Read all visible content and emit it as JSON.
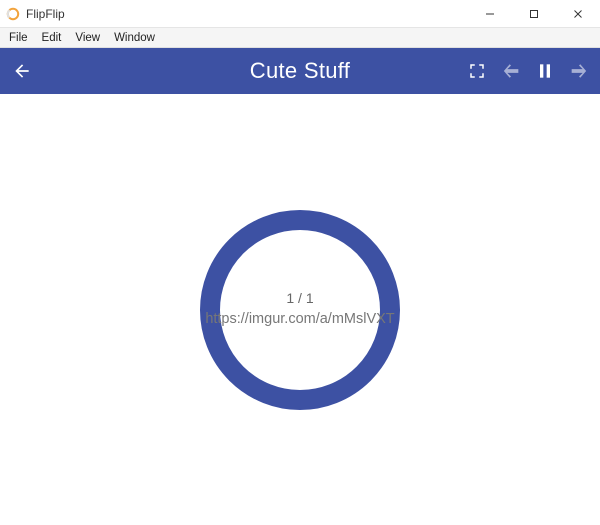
{
  "window": {
    "title": "FlipFlip"
  },
  "menu": {
    "items": [
      "File",
      "Edit",
      "View",
      "Window"
    ]
  },
  "appbar": {
    "title": "Cute Stuff"
  },
  "loader": {
    "count": "1 / 1",
    "url": "https://imgur.com/a/mMslVXT"
  },
  "colors": {
    "primary": "#3d51a3"
  }
}
